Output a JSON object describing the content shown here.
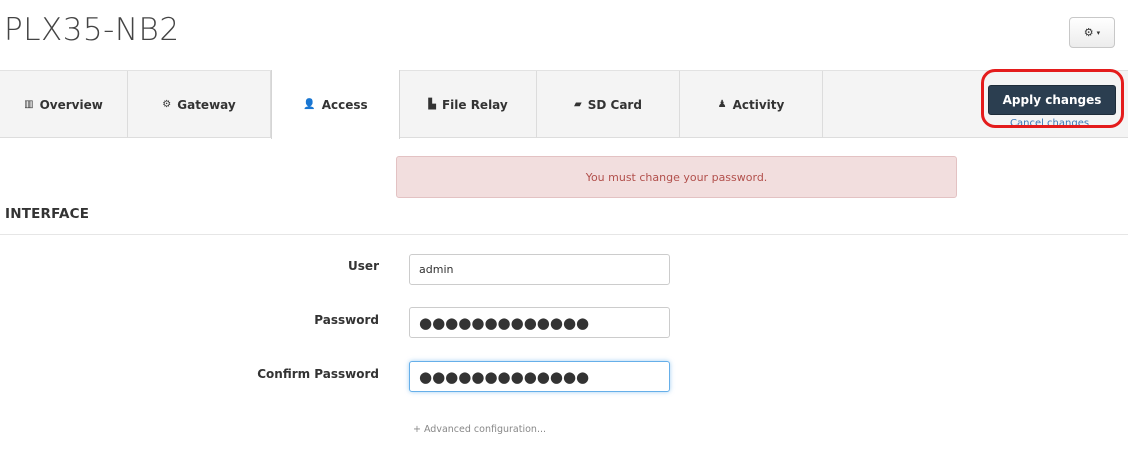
{
  "header": {
    "title": "PLX35-NB2",
    "settings_icon": "⚙",
    "settings_caret": "▾"
  },
  "tabs": [
    {
      "label": "Overview",
      "icon": "bar-chart-icon",
      "glyph": "▥"
    },
    {
      "label": "Gateway",
      "icon": "gear-icon",
      "glyph": "⚙"
    },
    {
      "label": "Access",
      "icon": "user-icon",
      "glyph": "👤",
      "active": true
    },
    {
      "label": "File Relay",
      "icon": "file-icon",
      "glyph": "▙"
    },
    {
      "label": "SD Card",
      "icon": "folder-icon",
      "glyph": "▰"
    },
    {
      "label": "Activity",
      "icon": "bell-icon",
      "glyph": "♟"
    }
  ],
  "actions": {
    "apply_label": "Apply changes",
    "cancel_label": "Cancel changes",
    "highlight_color": "#e41c1c"
  },
  "alert": {
    "message": "You must change your password."
  },
  "section": {
    "heading": "INTERFACE"
  },
  "form": {
    "user_label": "User",
    "user_value": "admin",
    "password_label": "Password",
    "password_value": "●●●●●●●●●●●●●",
    "confirm_label": "Confirm Password",
    "confirm_value": "●●●●●●●●●●●●●",
    "advanced_label": "+ Advanced configuration..."
  },
  "colors": {
    "apply_bg": "#2b3e50",
    "alert_bg": "#f2dede",
    "alert_text": "#b2504c",
    "link": "#3a77b5"
  }
}
